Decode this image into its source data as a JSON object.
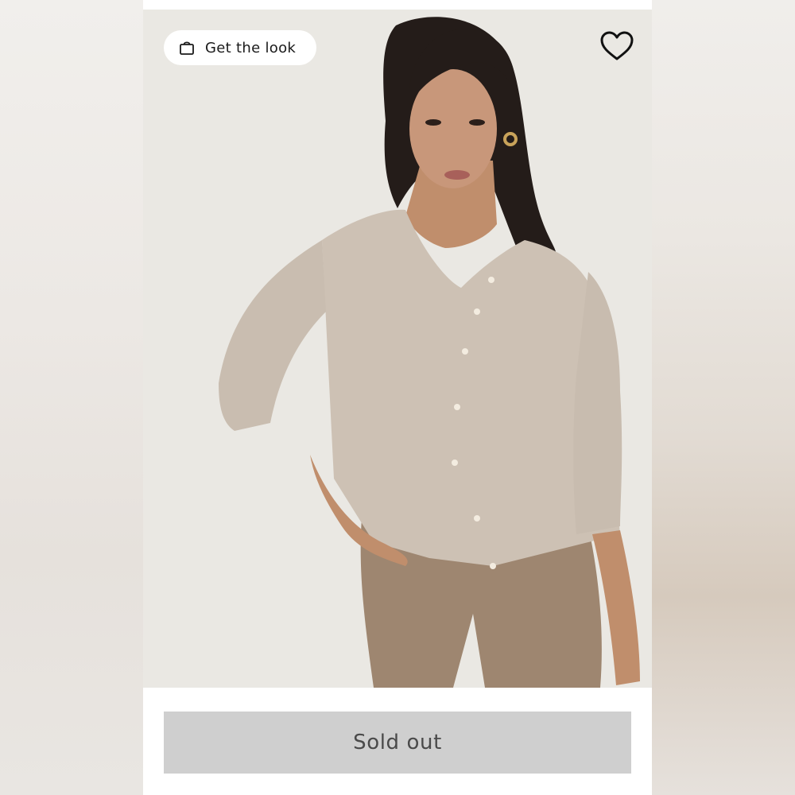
{
  "overlay": {
    "get_look_label": "Get the look",
    "bag_icon": "shopping-bag-icon",
    "heart_icon": "heart-outline-icon"
  },
  "product": {
    "image_subject": "model-in-beige-cardigan",
    "cardigan_color": "#cdc1b4",
    "pants_color": "#9e8670",
    "background_color": "#eae8e3"
  },
  "purchase": {
    "sold_out_label": "Sold out",
    "button_bg": "#cfcfcf",
    "button_text_color": "#4a4a4a"
  }
}
